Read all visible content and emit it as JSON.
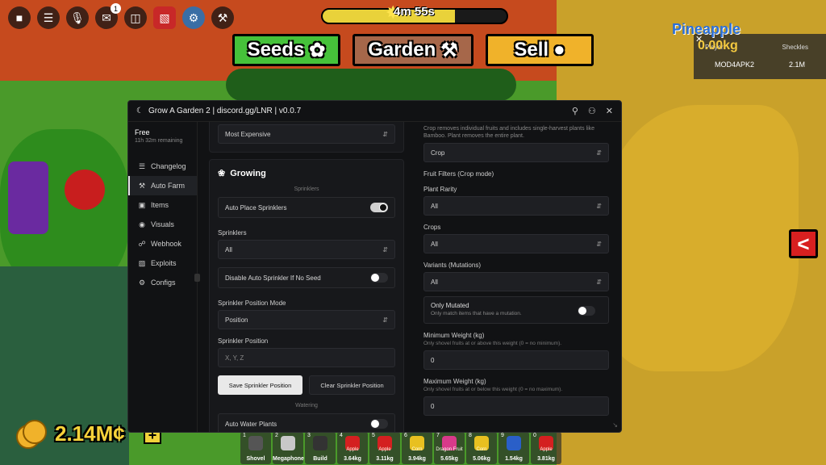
{
  "hud": {
    "notif_count": "1",
    "timer": "4m 55s",
    "timer_progress": 0.72,
    "seeds_label": "Seeds",
    "garden_label": "Garden",
    "sell_label": "Sell",
    "player_name": "Pineapple",
    "player_value": "0.00kg",
    "board": {
      "col_player": "Player",
      "col_shekles": "Sheckles",
      "row_player": "MOD4APK2",
      "row_shekles": "2.1M"
    },
    "money": "2.14M¢",
    "plus": "+"
  },
  "hotbar": [
    {
      "n": "1",
      "label": "Shovel",
      "sub": "",
      "color": "#555"
    },
    {
      "n": "2",
      "label": "Megaphone",
      "sub": "",
      "color": "#c8c8c8"
    },
    {
      "n": "3",
      "label": "Build",
      "sub": "",
      "color": "#333"
    },
    {
      "n": "4",
      "label": "3.64kg",
      "sub": "Apple",
      "color": "#d42020"
    },
    {
      "n": "5",
      "label": "3.11kg",
      "sub": "Apple",
      "color": "#d42020"
    },
    {
      "n": "6",
      "label": "3.94kg",
      "sub": "Corn",
      "color": "#e8c020"
    },
    {
      "n": "7",
      "label": "5.65kg",
      "sub": "Dragon Fruit",
      "color": "#d83a8a"
    },
    {
      "n": "8",
      "label": "5.06kg",
      "sub": "Corn",
      "color": "#e8c020"
    },
    {
      "n": "9",
      "label": "1.54kg",
      "sub": "",
      "color": "#2a5fc8"
    },
    {
      "n": "0",
      "label": "3.81kg",
      "sub": "Apple",
      "color": "#d42020"
    }
  ],
  "panel": {
    "title": "Grow A Garden 2 | discord.gg/LNR | v0.0.7",
    "tier": "Free",
    "remaining": "11h 32m remaining",
    "nav": [
      {
        "label": "Changelog",
        "icon": "☰"
      },
      {
        "label": "Auto Farm",
        "icon": "⚒"
      },
      {
        "label": "Items",
        "icon": "▣"
      },
      {
        "label": "Visuals",
        "icon": "◉"
      },
      {
        "label": "Webhook",
        "icon": "☍"
      },
      {
        "label": "Exploits",
        "icon": "▨"
      },
      {
        "label": "Configs",
        "icon": "⚙"
      }
    ],
    "left": {
      "sort_value": "Most Expensive",
      "section": "Growing",
      "sub_sprinklers": "Sprinklers",
      "auto_place": "Auto Place Sprinklers",
      "sprinklers_label": "Sprinklers",
      "sprinklers_value": "All",
      "disable_auto": "Disable Auto Sprinkler If No Seed",
      "pos_mode_label": "Sprinkler Position Mode",
      "pos_mode_value": "Position",
      "pos_label": "Sprinkler Position",
      "pos_placeholder": "X, Y, Z",
      "save_btn": "Save Sprinkler Position",
      "clear_btn": "Clear Sprinkler Position",
      "sub_watering": "Watering",
      "auto_water": "Auto Water Plants"
    },
    "right": {
      "crop_desc": "Crop removes individual fruits and includes single-harvest plants like Bamboo. Plant removes the entire plant.",
      "crop_value": "Crop",
      "filters_label": "Fruit Filters (Crop mode)",
      "rarity_label": "Plant Rarity",
      "rarity_value": "All",
      "crops_label": "Crops",
      "crops_value": "All",
      "variants_label": "Variants (Mutations)",
      "variants_value": "All",
      "only_mutated": "Only Mutated",
      "only_mutated_desc": "Only match items that have a mutation.",
      "min_label": "Minimum Weight (kg)",
      "min_desc": "Only shovel fruits at or above this weight (0 = no minimum).",
      "min_value": "0",
      "max_label": "Maximum Weight (kg)",
      "max_desc": "Only shovel fruits at or below this weight (0 = no maximum).",
      "max_value": "0"
    }
  }
}
